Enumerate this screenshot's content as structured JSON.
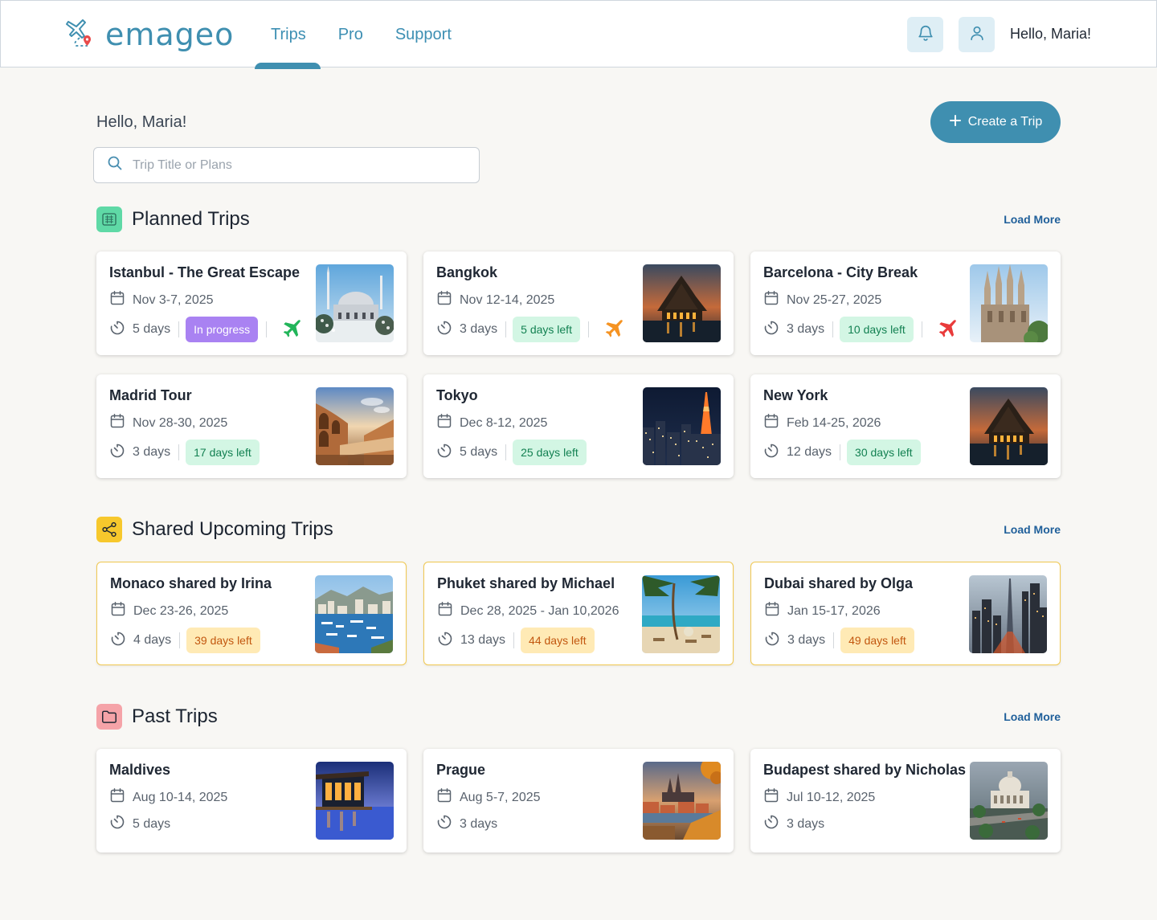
{
  "header": {
    "logo": "emageo",
    "nav": [
      "Trips",
      "Pro",
      "Support"
    ],
    "greeting": "Hello, Maria!"
  },
  "main": {
    "greeting": "Hello, Maria!",
    "create_label": "Create a Trip",
    "search_placeholder": "Trip Title or Plans"
  },
  "sections": {
    "planned": {
      "title": "Planned Trips",
      "load_more": "Load More",
      "trips": [
        {
          "title": "Istanbul - The Great Escape",
          "date": "Nov 3-7, 2025",
          "duration": "5 days",
          "status": "In progress",
          "plane_color": "#22b55a",
          "image": "istanbul"
        },
        {
          "title": "Bangkok",
          "date": "Nov 12-14, 2025",
          "duration": "3 days",
          "status": "5 days left",
          "plane_color": "#f59322",
          "image": "bangkok"
        },
        {
          "title": "Barcelona - City Break",
          "date": "Nov 25-27, 2025",
          "duration": "3 days",
          "status": "10 days left",
          "plane_color": "#e93b3b",
          "image": "barcelona"
        },
        {
          "title": "Madrid Tour",
          "date": "Nov 28-30, 2025",
          "duration": "3 days",
          "status": "17 days left",
          "image": "madrid"
        },
        {
          "title": "Tokyo",
          "date": "Dec 8-12, 2025",
          "duration": "5 days",
          "status": "25 days left",
          "image": "tokyo"
        },
        {
          "title": "New York",
          "date": "Feb 14-25, 2026",
          "duration": "12 days",
          "status": "30 days left",
          "image": "bangkok"
        }
      ]
    },
    "shared": {
      "title": "Shared Upcoming Trips",
      "load_more": "Load More",
      "trips": [
        {
          "title": "Monaco shared by Irina",
          "date": "Dec 23-26, 2025",
          "duration": "4 days",
          "status": "39 days left",
          "image": "monaco"
        },
        {
          "title": "Phuket shared by Michael",
          "date": "Dec 28, 2025 - Jan 10,2026",
          "duration": "13 days",
          "status": "44 days left",
          "image": "phuket"
        },
        {
          "title": "Dubai shared by Olga",
          "date": "Jan 15-17, 2026",
          "duration": "3 days",
          "status": "49 days left",
          "image": "dubai"
        }
      ]
    },
    "past": {
      "title": "Past Trips",
      "load_more": "Load More",
      "trips": [
        {
          "title": "Maldives",
          "date": "Aug 10-14, 2025",
          "duration": "5 days",
          "image": "maldives"
        },
        {
          "title": "Prague",
          "date": "Aug 5-7, 2025",
          "duration": "3 days",
          "image": "prague"
        },
        {
          "title": "Budapest shared by Nicholas",
          "date": "Jul 10-12, 2025",
          "duration": "3 days",
          "image": "budapest"
        }
      ]
    }
  },
  "colors": {
    "accent": "#3f8fb0",
    "planned_icon_bg": "#5fd9a6",
    "shared_icon_bg": "#f7c82c",
    "past_icon_bg": "#f5a3a8"
  }
}
